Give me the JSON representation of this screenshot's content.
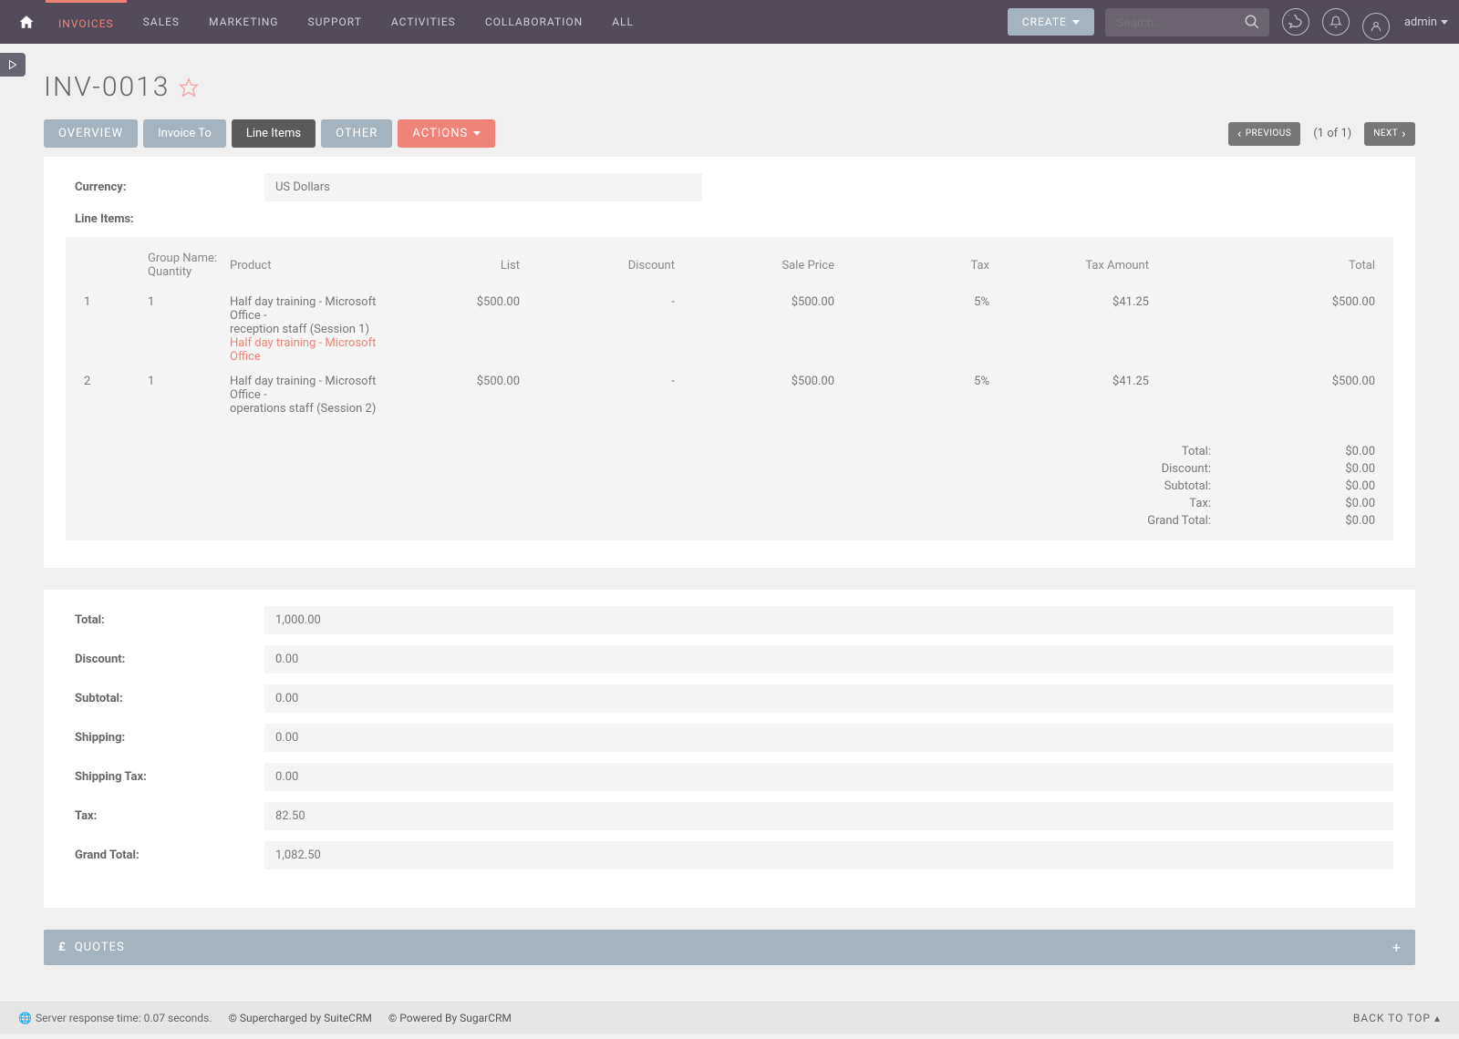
{
  "topnav": {
    "items": [
      "INVOICES",
      "SALES",
      "MARKETING",
      "SUPPORT",
      "ACTIVITIES",
      "COLLABORATION",
      "ALL"
    ],
    "create": "CREATE",
    "search_placeholder": "Search...",
    "admin": "admin"
  },
  "title": "INV-0013",
  "tabs": {
    "overview": "OVERVIEW",
    "invoice_to": "Invoice To",
    "line_items": "Line Items",
    "other": "OTHER",
    "actions": "ACTIONS"
  },
  "pager": {
    "previous": "PREVIOUS",
    "count": "(1 of 1)",
    "next": "NEXT"
  },
  "currency_label": "Currency:",
  "currency_value": "US Dollars",
  "line_items_label": "Line Items:",
  "group_name_label": "Group Name:",
  "li_headers": {
    "qty": "Quantity",
    "product": "Product",
    "list": "List",
    "discount": "Discount",
    "sale": "Sale Price",
    "tax": "Tax",
    "tax_amount": "Tax Amount",
    "total": "Total"
  },
  "line_items": [
    {
      "num": "1",
      "qty": "1",
      "product_desc": "Half day training - Microsoft Office -\nreception staff (Session 1)",
      "product_link": "Half day training - Microsoft Office",
      "list": "$500.00",
      "discount": "-",
      "sale": "$500.00",
      "tax": "5%",
      "tax_amount": "$41.25",
      "total": "$500.00"
    },
    {
      "num": "2",
      "qty": "1",
      "product_desc": "Half day training - Microsoft Office -\noperations staff (Session 2)",
      "product_link": "",
      "list": "$500.00",
      "discount": "-",
      "sale": "$500.00",
      "tax": "5%",
      "tax_amount": "$41.25",
      "total": "$500.00"
    }
  ],
  "group_totals": [
    {
      "label": "Total:",
      "value": "$0.00"
    },
    {
      "label": "Discount:",
      "value": "$0.00"
    },
    {
      "label": "Subtotal:",
      "value": "$0.00"
    },
    {
      "label": "Tax:",
      "value": "$0.00"
    },
    {
      "label": "Grand Total:",
      "value": "$0.00"
    }
  ],
  "summary": [
    {
      "label": "Total:",
      "value": "1,000.00"
    },
    {
      "label": "Discount:",
      "value": "0.00"
    },
    {
      "label": "Subtotal:",
      "value": "0.00"
    },
    {
      "label": "Shipping:",
      "value": "0.00"
    },
    {
      "label": "Shipping Tax:",
      "value": "0.00"
    },
    {
      "label": "Tax:",
      "value": "82.50"
    },
    {
      "label": "Grand Total:",
      "value": "1,082.50"
    }
  ],
  "quotes_label": "QUOTES",
  "footer": {
    "response": "Server response time: 0.07 seconds.",
    "suitecrm": "© Supercharged by SuiteCRM",
    "sugarcrm": "© Powered By SugarCRM",
    "back_top": "BACK TO TOP"
  }
}
